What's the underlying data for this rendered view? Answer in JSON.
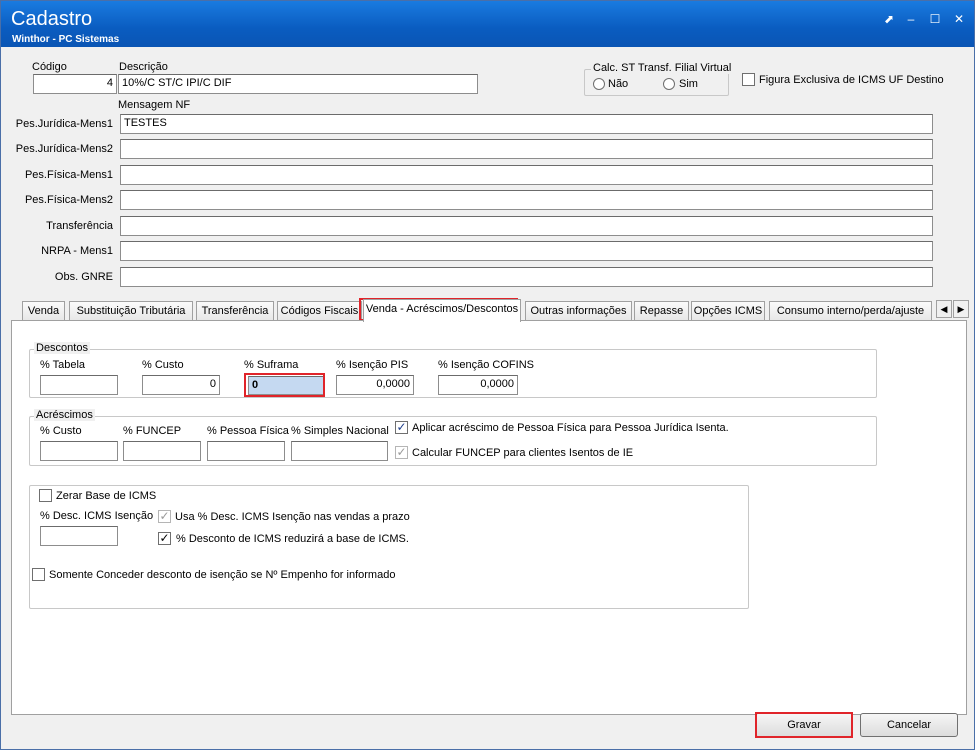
{
  "window": {
    "title": "Cadastro",
    "subtitle": "Winthor - PC Sistemas",
    "controls": {
      "restore": "⬈",
      "minimize": "–",
      "maximize": "☐",
      "close": "✕"
    }
  },
  "header": {
    "codigo_label": "Código",
    "codigo_value": "4",
    "descricao_label": "Descrição",
    "descricao_value": "10%/C ST/C IPI/C DIF",
    "calc_st_title": "Calc. ST Transf. Filial Virtual",
    "calc_st_nao": "Não",
    "calc_st_sim": "Sim",
    "figura_exclusiva_label": "Figura Exclusiva de ICMS UF Destino"
  },
  "mensagem": {
    "title": "Mensagem NF",
    "rows": [
      {
        "label": "Pes.Jurídica-Mens1",
        "value": "TESTES"
      },
      {
        "label": "Pes.Jurídica-Mens2",
        "value": ""
      },
      {
        "label": "Pes.Física-Mens1",
        "value": ""
      },
      {
        "label": "Pes.Física-Mens2",
        "value": ""
      },
      {
        "label": "Transferência",
        "value": ""
      },
      {
        "label": "NRPA - Mens1",
        "value": ""
      },
      {
        "label": "Obs. GNRE",
        "value": ""
      }
    ]
  },
  "tabs": [
    "Venda",
    "Substituição Tributária",
    "Transferência",
    "Códigos Fiscais",
    "Venda - Acréscimos/Descontos",
    "Outras informações",
    "Repasse",
    "Opções ICMS",
    "Consumo interno/perda/ajuste"
  ],
  "active_tab": "Venda - Acréscimos/Descontos",
  "descontos": {
    "title": "Descontos",
    "tabela_label": "% Tabela",
    "tabela_value": "",
    "custo_label": "% Custo",
    "custo_value": "0",
    "suframa_label": "% Suframa",
    "suframa_value": "0",
    "isencao_pis_label": "% Isenção PIS",
    "isencao_pis_value": "0,0000",
    "isencao_cofins_label": "% Isenção COFINS",
    "isencao_cofins_value": "0,0000"
  },
  "acrescimos": {
    "title": "Acréscimos",
    "custo_label": "% Custo",
    "custo_value": "",
    "funcep_label": "% FUNCEP",
    "funcep_value": "",
    "pessoa_fisica_label": "% Pessoa Física",
    "pessoa_fisica_value": "",
    "simples_label": "% Simples Nacional",
    "simples_value": "",
    "aplicar_label": "Aplicar acréscimo de Pessoa Física para Pessoa Jurídica Isenta.",
    "calcular_label": "Calcular FUNCEP para clientes Isentos de IE"
  },
  "icms": {
    "zerar_label": "Zerar Base de ICMS",
    "desc_isencao_label": "% Desc. ICMS Isenção",
    "desc_isencao_value": "",
    "usa_label": "Usa % Desc. ICMS Isenção nas vendas a prazo",
    "desconto_label": "% Desconto de ICMS reduzirá a base de ICMS."
  },
  "empenho_label": "Somente Conceder desconto de isenção se Nº Empenho for informado",
  "buttons": {
    "gravar": "Gravar",
    "cancelar": "Cancelar"
  },
  "colors": {
    "title_bar": "#0a5cc0",
    "highlight": "#e0242a",
    "focused_field": "#c5d9f1"
  }
}
